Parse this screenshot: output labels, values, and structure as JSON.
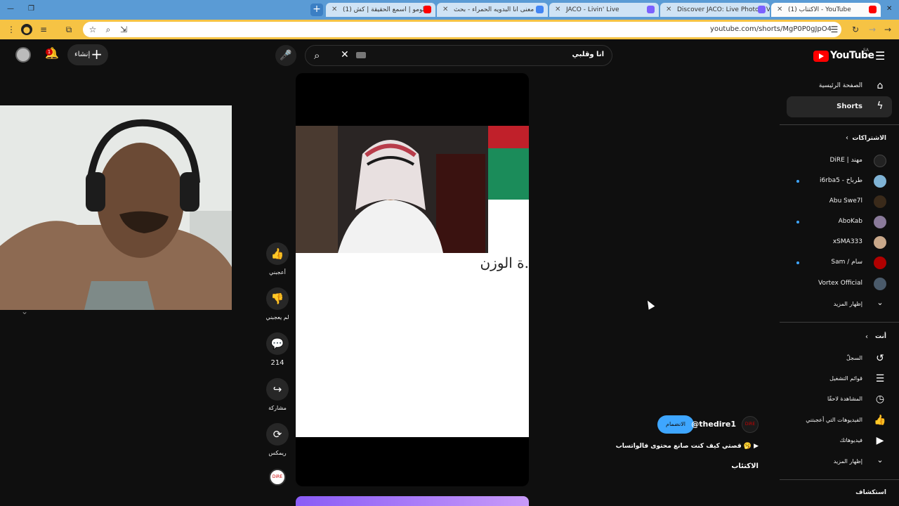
{
  "browser": {
    "tabs": [
      {
        "title": "(1) الاكتتاب - YouTube",
        "fav": "#ff0000",
        "active": true
      },
      {
        "title": "Discover JACO: Live Photos, Vid",
        "fav": "#7b61ff",
        "active": false
      },
      {
        "title": "JACO - Livin' Live",
        "fav": "#7b61ff",
        "active": false
      },
      {
        "title": "ش معنى انا البدويه الحمراء - بحث",
        "fav": "#4285f4",
        "active": false
      },
      {
        "title": "(1) سلومو | اسمع الحقيقة | كش",
        "fav": "#ff0000",
        "active": false
      }
    ],
    "new_tab": "+",
    "url": "youtube.com/shorts/MgP0P0gJpO4"
  },
  "header": {
    "search_value": "انا وقلبي",
    "create_label": "إنشاء",
    "notif_count": "1",
    "logo_text": "YouTube",
    "logo_country": "SA"
  },
  "sidebar": {
    "home": "الصفحة الرئيسية",
    "shorts": "Shorts",
    "subs_heading": "الاشتراكات",
    "subs": [
      {
        "name": "DiRE | مهند",
        "color": "#222",
        "dot": false
      },
      {
        "name": "i6rba5 - طرباخ",
        "color": "#7fb3d5",
        "dot": true
      },
      {
        "name": "Abu Swe7l",
        "color": "#3a2a1a",
        "dot": false
      },
      {
        "name": "AboKab",
        "color": "#8a7a9a",
        "dot": true
      },
      {
        "name": "xSMA333",
        "color": "#c9a88a",
        "dot": false
      },
      {
        "name": "Sam / سام",
        "color": "#b00000",
        "dot": true
      },
      {
        "name": "Vortex Official",
        "color": "#4a5a6a",
        "dot": false
      }
    ],
    "show_more": "إظهار المزيد",
    "you_heading": "أنت",
    "you_items": [
      "السجلّ",
      "قوائم التشغيل",
      "المشاهدة لاحقًا",
      "الفيديوهات التي أعجبتني",
      "فيديوهاتك"
    ],
    "show_more2": "إظهار المزيد",
    "explore_heading": "استكشاف"
  },
  "video": {
    "overlay_text": "ة الوزن.",
    "progress": 0.32
  },
  "actions": {
    "like": "أعجبني",
    "dislike": "لم يعجبني",
    "comments": "214",
    "share": "مشاركة",
    "remix": "ريمكس"
  },
  "channel": {
    "handle": "@thedire1",
    "join_label": "الانضمام",
    "avatar_text": "DiRE",
    "description": "قصتي كيف كنت صانع محتوى فالواتساب 🥱",
    "title": "الاكتئاب"
  }
}
